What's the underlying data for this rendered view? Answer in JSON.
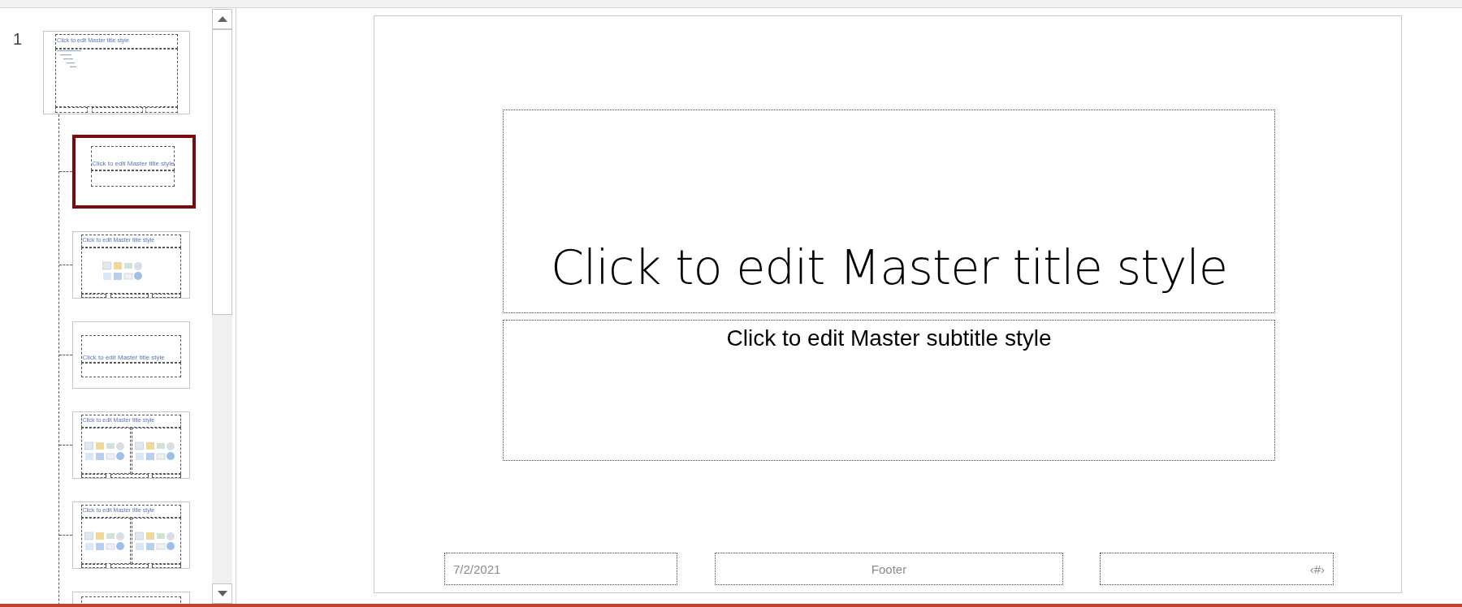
{
  "slide_panel": {
    "slide_number": "1",
    "thumbnails": [
      {
        "kind": "master",
        "title": "Click to edit Master title style",
        "selected": false
      },
      {
        "kind": "title",
        "title": "Click to edit Master title style",
        "selected": true
      },
      {
        "kind": "content",
        "title": "Click to edit Master title style",
        "selected": false
      },
      {
        "kind": "section",
        "title": "Click to edit Master title style",
        "selected": false
      },
      {
        "kind": "two_content",
        "title": "Click to edit Master title style",
        "selected": false
      },
      {
        "kind": "comparison",
        "title": "Click to edit Master title style",
        "selected": false
      },
      {
        "kind": "partial",
        "selected": false
      }
    ]
  },
  "slide": {
    "title": "Click to edit Master title style",
    "subtitle": "Click to edit Master subtitle style",
    "date": "7/2/2021",
    "footer": "Footer",
    "slide_number": "‹#›"
  }
}
